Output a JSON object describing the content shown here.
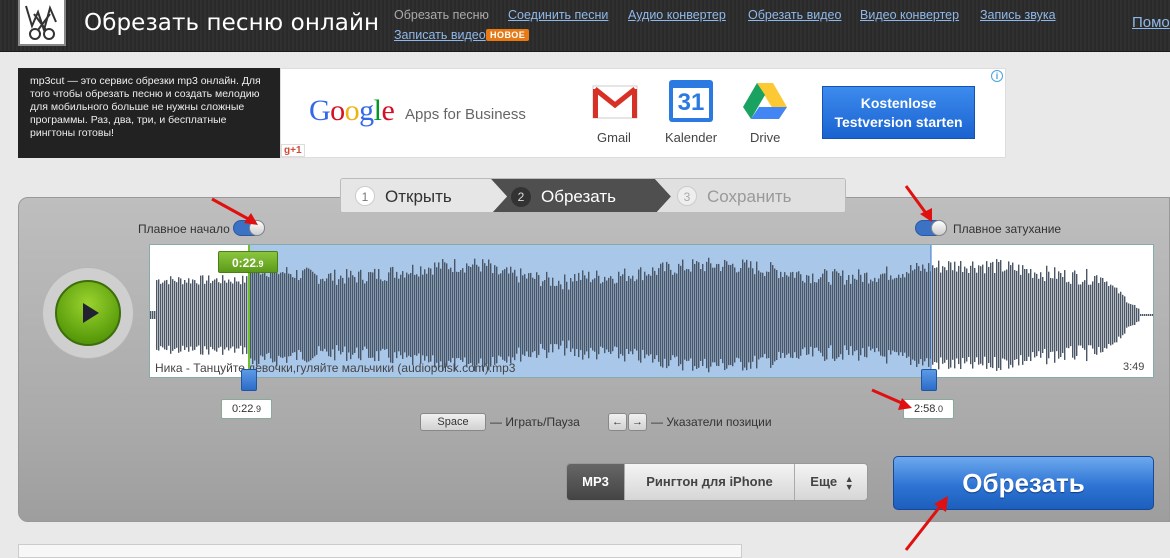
{
  "header": {
    "site_title": "Обрезать песню онлайн",
    "nav": [
      "Обрезать песню",
      "Соединить песни",
      "Аудио конвертер",
      "Обрезать видео",
      "Видео конвертер",
      "Запись звука",
      "Помо",
      "Записать видео"
    ],
    "badge_new": "НОВОЕ"
  },
  "intro_text": "mp3cut — это сервис обрезки mp3 онлайн. Для того чтобы обрезать песню и создать мелодию для мобильного больше не нужны сложные программы. Раз, два, три, и бесплатные рингтоны готовы!",
  "ad": {
    "google": "Google",
    "apps": "Apps for Business",
    "apps_list": [
      "Gmail",
      "Kalender",
      "Drive"
    ],
    "calendar_day": "31",
    "gplus": "g+1",
    "cta": "Kostenlose Testversion starten",
    "info": "i"
  },
  "steps": [
    {
      "num": "1",
      "label": "Открыть"
    },
    {
      "num": "2",
      "label": "Обрезать"
    },
    {
      "num": "3",
      "label": "Сохранить"
    }
  ],
  "editor": {
    "fade_in_label": "Плавное начало",
    "fade_out_label": "Плавное затухание",
    "track_name": "Ника - Танцуйте девочки,гуляйте мальчики  (audiopoisk.com).mp3",
    "duration": "3:49",
    "start_flag": {
      "main": "0:22",
      "frac": "9"
    },
    "start_box": {
      "main": "0:22",
      "frac": "9"
    },
    "end_box": {
      "main": "2:58",
      "frac": "0"
    },
    "key_space": "Space",
    "hint_play": "— Играть/Пауза",
    "key_left": "←",
    "key_right": "→",
    "hint_pos": "— Указатели позиции",
    "formats": [
      "MP3",
      "Рингтон для iPhone",
      "Еще"
    ],
    "cut_button": "Обрезать"
  }
}
